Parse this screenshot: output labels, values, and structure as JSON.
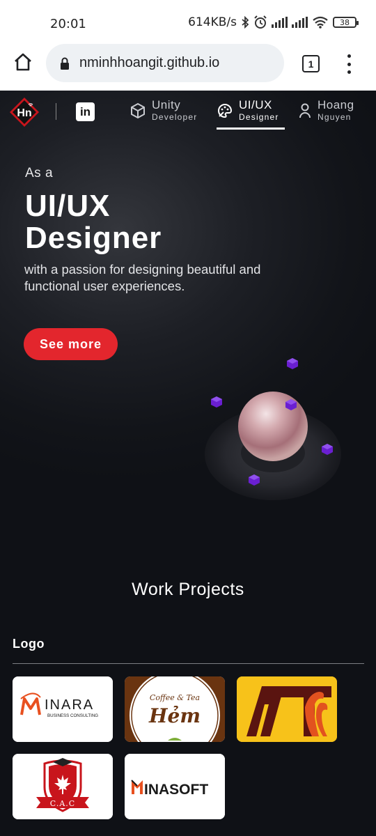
{
  "status_bar": {
    "time": "20:01",
    "net_speed": "614KB/s",
    "battery": "38"
  },
  "browser": {
    "url": "nminhhoangit.github.io",
    "tab_count": "1"
  },
  "site_nav": {
    "logo_text": "Hn",
    "linkedin_label": "in",
    "items": [
      {
        "line1": "Unity",
        "line2": "Developer",
        "icon": "unity-icon",
        "active": false
      },
      {
        "line1": "UI/UX",
        "line2": "Designer",
        "icon": "palette-icon",
        "active": true
      },
      {
        "line1": "Hoang",
        "line2": "Nguyen",
        "icon": "person-icon",
        "active": false
      }
    ]
  },
  "hero": {
    "kicker": "As a",
    "title_line1": "UI/UX",
    "title_line2": "Designer",
    "subtitle": "with a passion for designing beautiful and functional user experiences.",
    "cta": "See more"
  },
  "work": {
    "section_title": "Work Projects",
    "category": "Logo",
    "logos": [
      {
        "name": "Minara",
        "big": "INARA",
        "sub": "BUSINESS CONSULTING"
      },
      {
        "name": "Hem Coffee & Tea",
        "top": "Coffee & Tea",
        "main": "Hẻm"
      },
      {
        "name": "AT"
      },
      {
        "name": "CAC",
        "text": "C.A.C"
      },
      {
        "name": "Minasoft",
        "text": "INASOFT"
      }
    ]
  },
  "colors": {
    "accent": "#e3262d",
    "bg": "#0f1116",
    "cube": "#6a1fd1"
  }
}
